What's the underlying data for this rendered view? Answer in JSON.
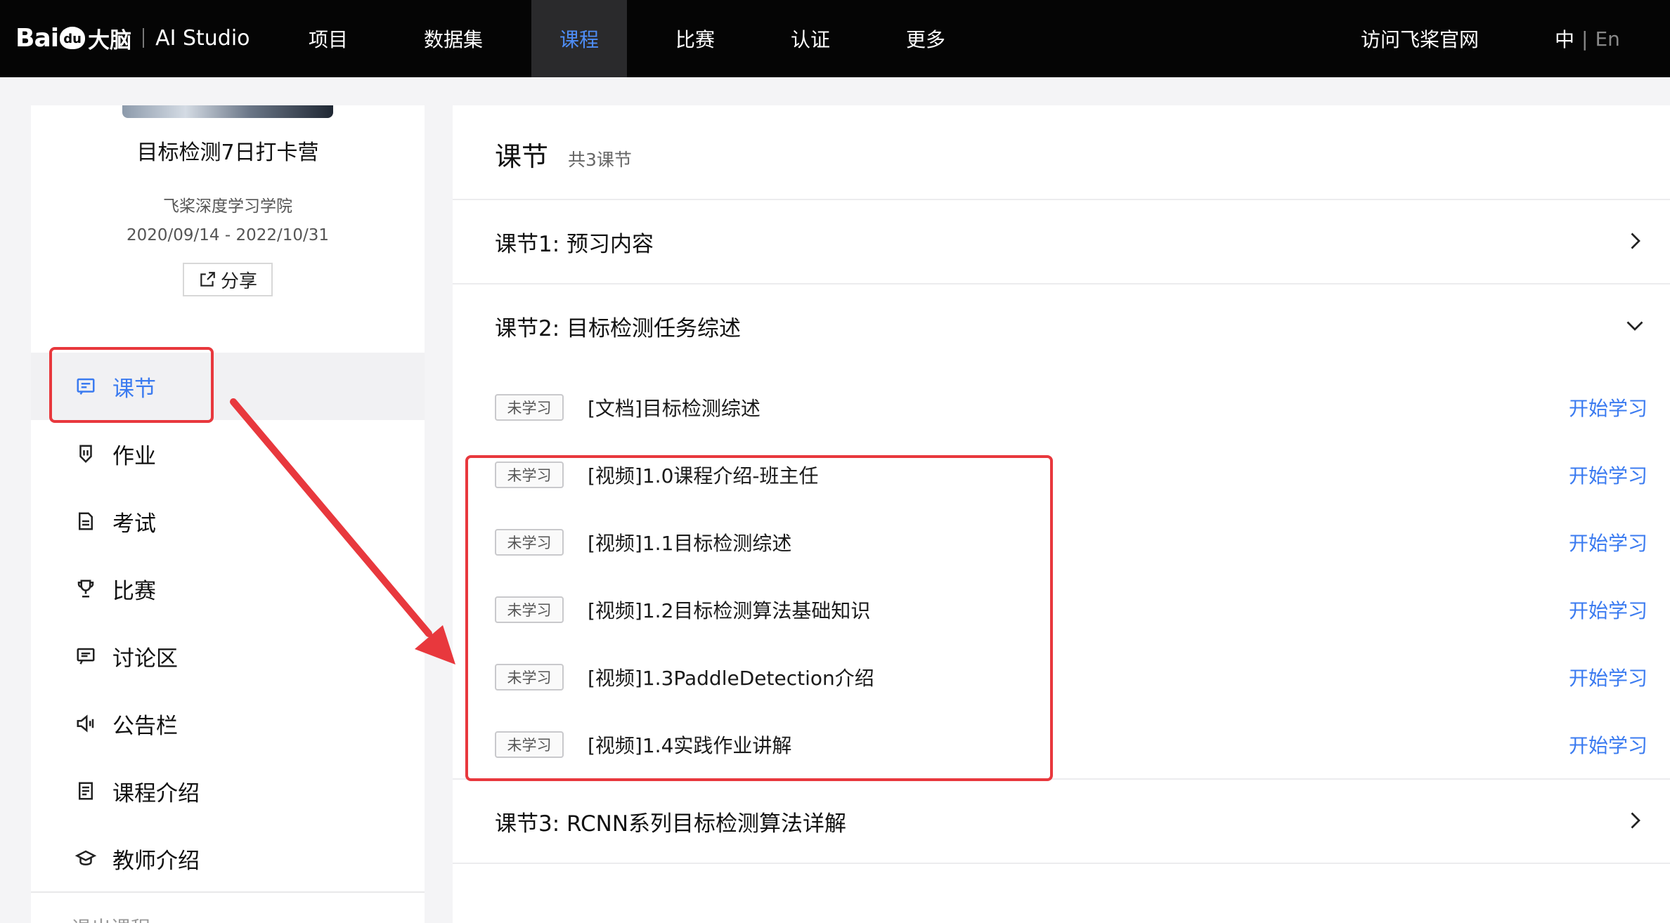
{
  "header": {
    "logo_bai": "Bai",
    "logo_du": "du",
    "logo_danao": "大脑",
    "logo_studio": "AI Studio",
    "nav": [
      {
        "label": "项目",
        "active": false
      },
      {
        "label": "数据集",
        "active": false
      },
      {
        "label": "课程",
        "active": true
      },
      {
        "label": "比赛",
        "active": false
      },
      {
        "label": "认证",
        "active": false
      },
      {
        "label": "更多",
        "active": false
      }
    ],
    "official_link": "访问飞桨官网",
    "lang_zh": "中",
    "lang_sep": "|",
    "lang_en": "En"
  },
  "sidebar": {
    "course_title": "目标检测7日打卡营",
    "org": "飞桨深度学习学院",
    "date_range": "2020/09/14 - 2022/10/31",
    "share_label": "分享",
    "menu": [
      {
        "label": "课节",
        "icon": "lesson-icon",
        "active": true
      },
      {
        "label": "作业",
        "icon": "homework-icon",
        "active": false
      },
      {
        "label": "考试",
        "icon": "exam-icon",
        "active": false
      },
      {
        "label": "比赛",
        "icon": "trophy-icon",
        "active": false
      },
      {
        "label": "讨论区",
        "icon": "discussion-icon",
        "active": false
      },
      {
        "label": "公告栏",
        "icon": "announcement-icon",
        "active": false
      },
      {
        "label": "课程介绍",
        "icon": "course-intro-icon",
        "active": false
      },
      {
        "label": "教师介绍",
        "icon": "teacher-icon",
        "active": false
      }
    ],
    "cut_item": "退出课程"
  },
  "main": {
    "title": "课节",
    "count": "共3课节",
    "sections": [
      {
        "title": "课节1: 预习内容",
        "expanded": false
      },
      {
        "title": "课节2: 目标检测任务综述",
        "expanded": true
      },
      {
        "title": "课节3: RCNN系列目标检测算法详解",
        "expanded": false
      }
    ],
    "lessons": [
      {
        "status": "未学习",
        "title": "[文档]目标检测综述",
        "action": "开始学习"
      },
      {
        "status": "未学习",
        "title": "[视频]1.0课程介绍-班主任",
        "action": "开始学习"
      },
      {
        "status": "未学习",
        "title": "[视频]1.1目标检测综述",
        "action": "开始学习"
      },
      {
        "status": "未学习",
        "title": "[视频]1.2目标检测算法基础知识",
        "action": "开始学习"
      },
      {
        "status": "未学习",
        "title": "[视频]1.3PaddleDetection介绍",
        "action": "开始学习"
      },
      {
        "status": "未学习",
        "title": "[视频]1.4实践作业讲解",
        "action": "开始学习"
      }
    ]
  },
  "colors": {
    "accent": "#3b7bf0",
    "topbar": "#050505",
    "annotation": "#e8383d"
  }
}
